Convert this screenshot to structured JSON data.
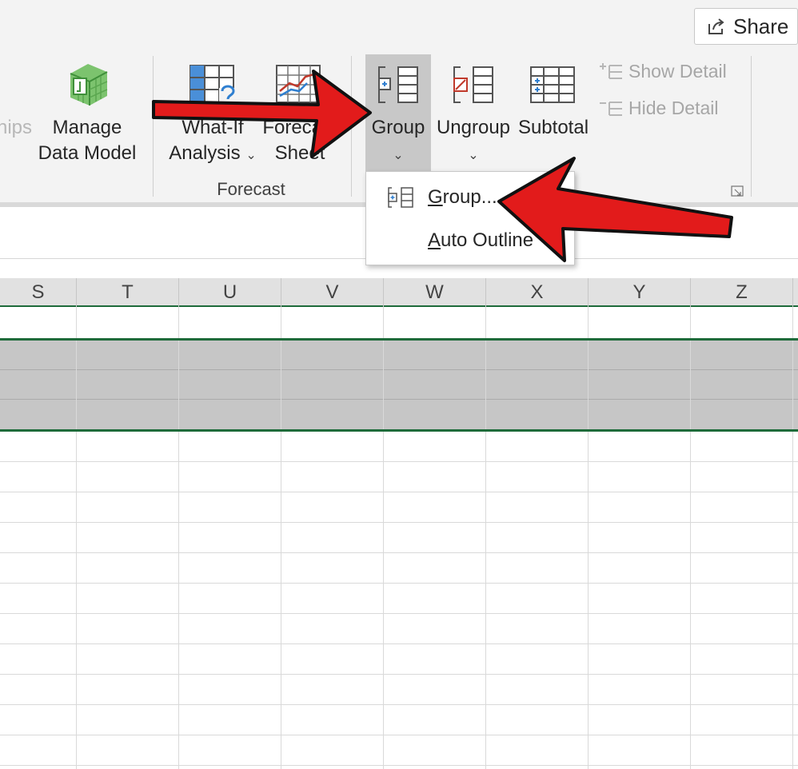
{
  "ribbon": {
    "share_label": "Share",
    "partial_left_label": "nips",
    "manage_data_model": {
      "line1": "Manage",
      "line2": "Data Model"
    },
    "what_if": {
      "line1": "What-If",
      "line2": "Analysis"
    },
    "forecast_sheet": {
      "line1": "Forecast",
      "line2": "Sheet"
    },
    "forecast_group_name": "Forecast",
    "group_button": "Group",
    "ungroup_button": "Ungroup",
    "subtotal_button": "Subtotal",
    "show_detail": "Show Detail",
    "hide_detail": "Hide Detail"
  },
  "group_menu": {
    "items": [
      {
        "prefix": "G",
        "rest": "roup..."
      },
      {
        "prefix": "A",
        "rest": "uto Outline"
      }
    ]
  },
  "grid": {
    "columns": [
      "S",
      "T",
      "U",
      "V",
      "W",
      "X",
      "Y",
      "Z"
    ]
  },
  "colors": {
    "selection_border": "#1e6b3a",
    "annotation_arrow": "#e21b1b",
    "selected_rows": "#c6c6c6"
  }
}
